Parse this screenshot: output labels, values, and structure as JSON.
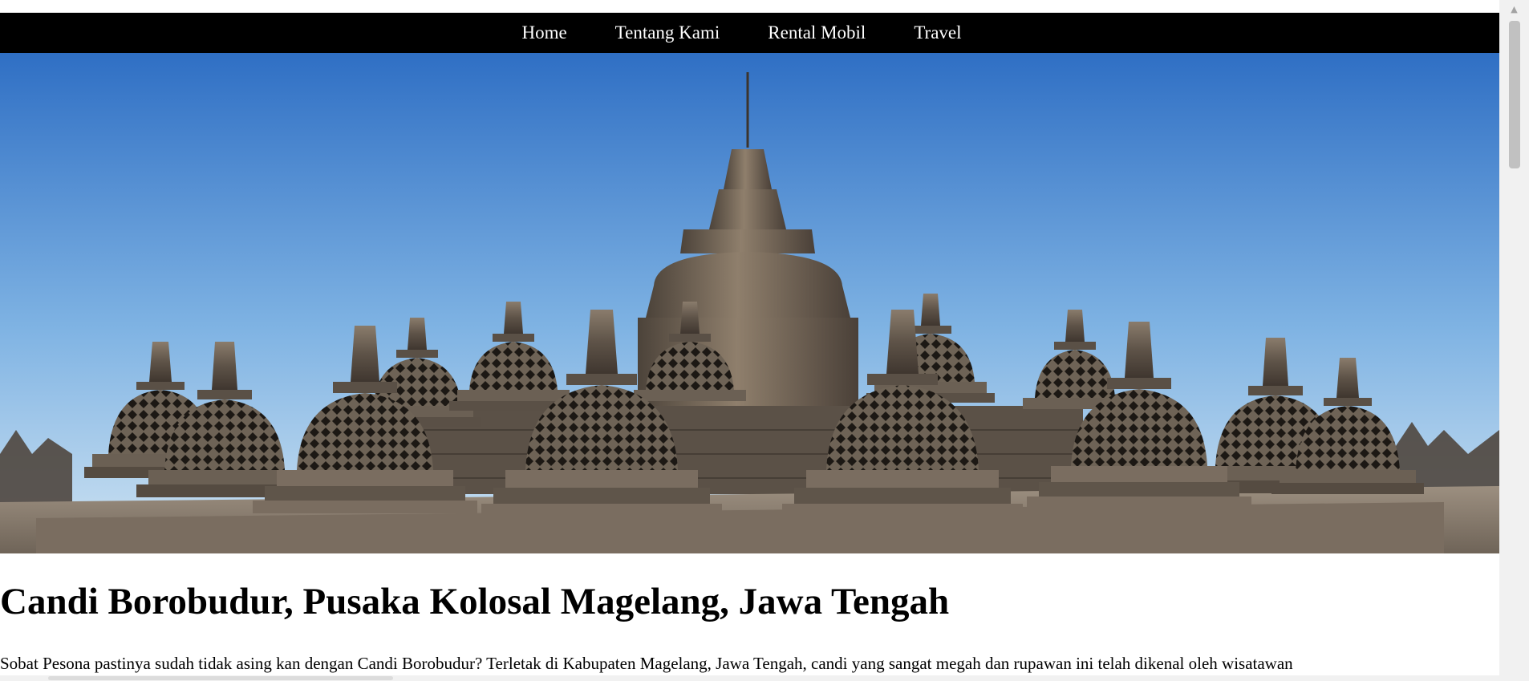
{
  "nav": {
    "items": [
      {
        "label": "Home"
      },
      {
        "label": "Tentang Kami"
      },
      {
        "label": "Rental Mobil"
      },
      {
        "label": "Travel"
      }
    ]
  },
  "hero": {
    "icon": "borobudur-photo"
  },
  "article": {
    "title": "Candi Borobudur, Pusaka Kolosal Magelang, Jawa Tengah",
    "body": "Sobat Pesona pastinya sudah tidak asing kan dengan Candi Borobudur? Terletak di Kabupaten Magelang, Jawa Tengah, candi yang sangat megah dan rupawan ini telah dikenal oleh wisatawan"
  },
  "colors": {
    "nav_bg": "#000000",
    "nav_text": "#ffffff",
    "sky_top": "#2f6fc4",
    "sky_bottom": "#cfe3f2",
    "stone": "#6b6054"
  }
}
